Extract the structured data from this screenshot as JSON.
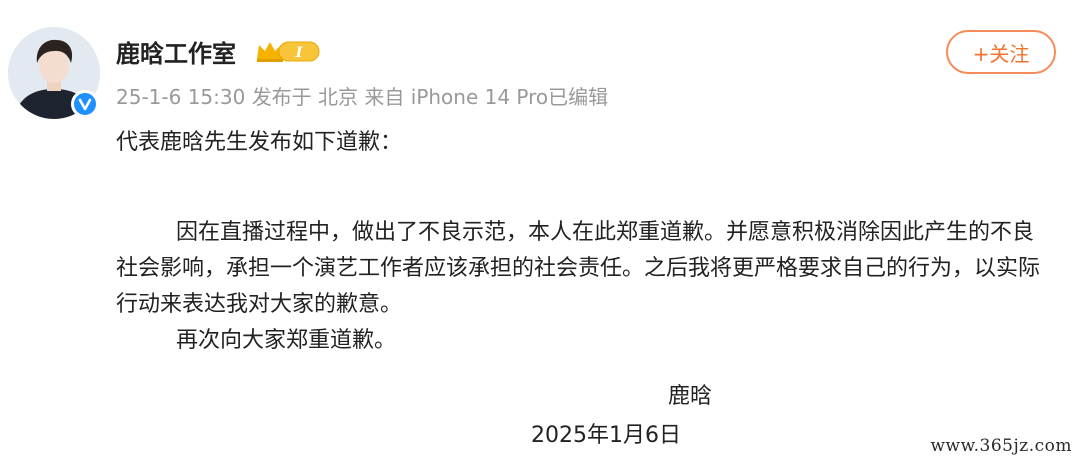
{
  "post": {
    "author": {
      "name": "鹿晗工作室",
      "vip_level": "I",
      "verified": true
    },
    "meta": {
      "date": "25-1-6 15:30",
      "location": "发布于 北京",
      "source": "来自 iPhone 14 Pro",
      "edited": "已编辑"
    },
    "follow_label": "+关注",
    "content": {
      "intro": "代表鹿晗先生发布如下道歉：",
      "paragraph1": "因在直播过程中，做出了不良示范，本人在此郑重道歉。并愿意积极消除因此产生的不良社会影响，承担一个演艺工作者应该承担的社会责任。之后我将更严格要求自己的行为，以实际行动来表达我对大家的歉意。",
      "paragraph2": "再次向大家郑重道歉。",
      "signature": "鹿晗",
      "date": "2025年1月6日"
    }
  },
  "watermark": "www.365jz.com",
  "colors": {
    "accent": "#f2732f",
    "verified": "#1e90ff",
    "meta_text": "#999999",
    "vip_gold": "#f5b300"
  },
  "icons": {
    "verified": "verified-check-icon",
    "vip": "crown-icon"
  }
}
